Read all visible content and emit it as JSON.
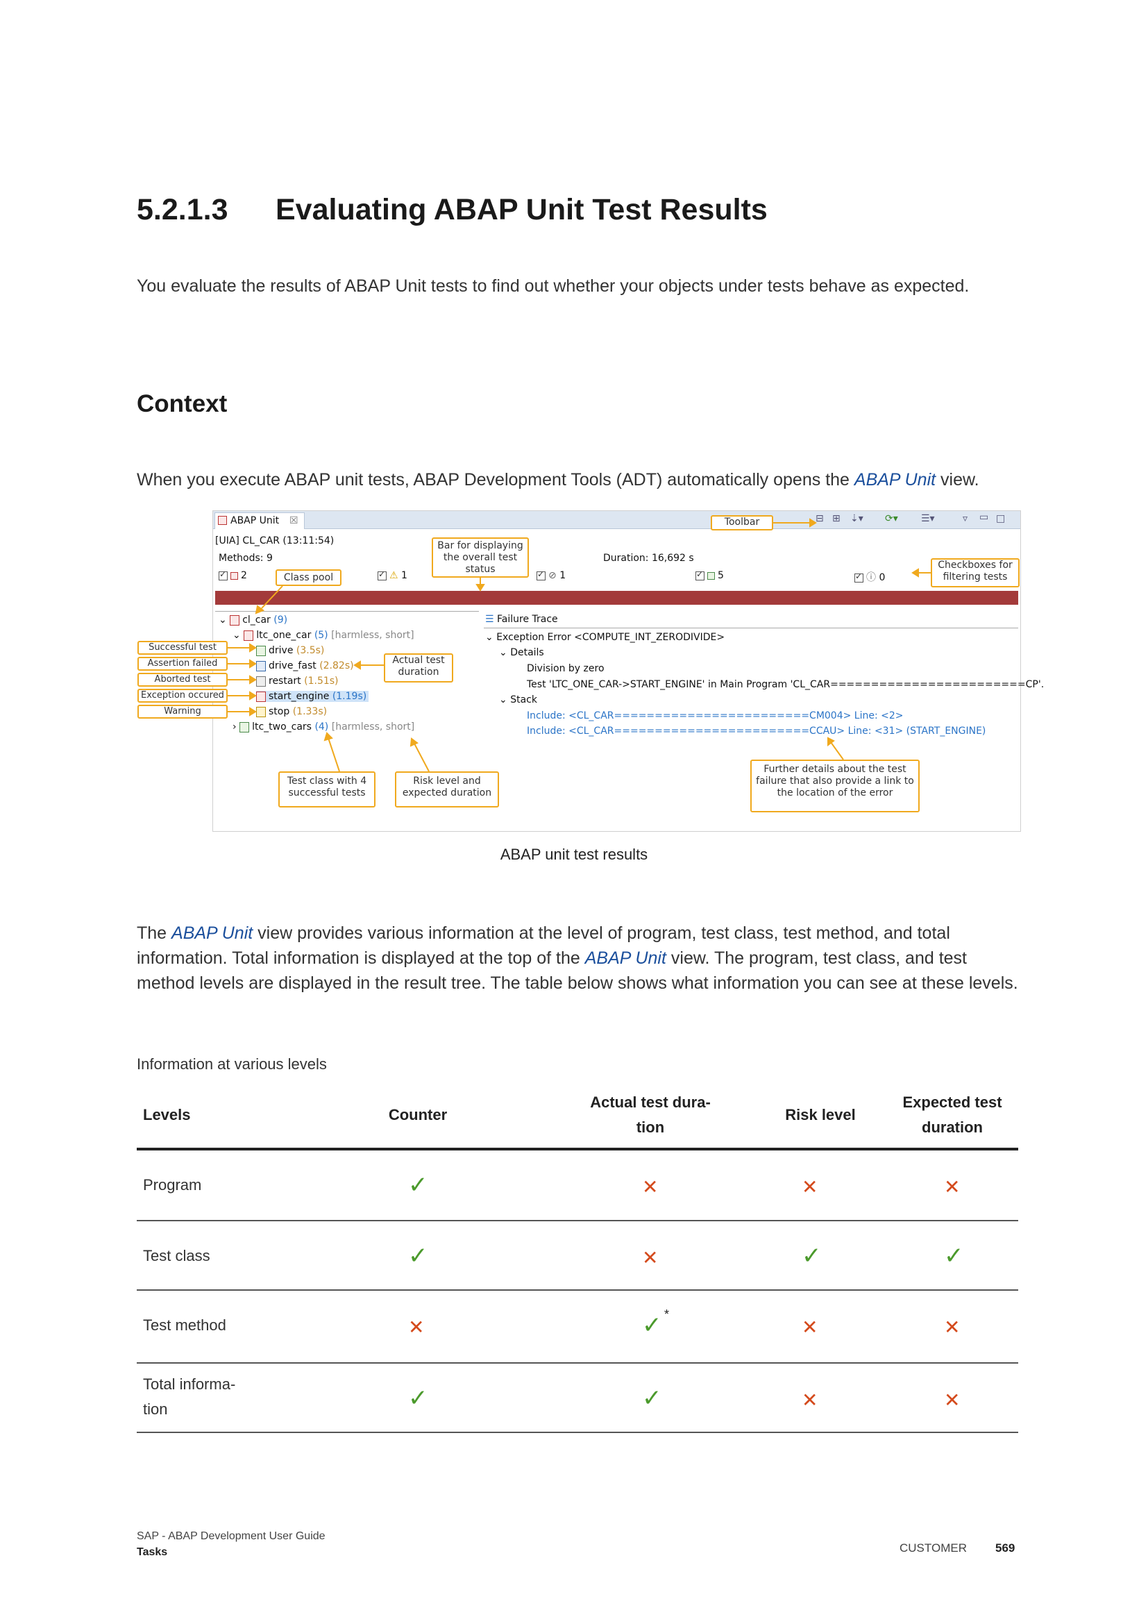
{
  "section": {
    "number": "5.2.1.3",
    "title": "Evaluating ABAP Unit Test Results"
  },
  "intro": "You evaluate the results of ABAP Unit tests to find out whether your objects under tests behave as expected.",
  "context": {
    "heading": "Context",
    "text_before": "When you execute ABAP unit tests, ABAP Development Tools (ADT) automatically opens the ",
    "link": "ABAP Unit",
    "text_after": " view."
  },
  "figure": {
    "tab_label": "ABAP Unit",
    "tab_close": "☒",
    "run_label": "[UIA] CL_CAR (13:11:54)",
    "methods": "Methods: 9",
    "duration": "Duration: 16,692 s",
    "counters": {
      "success": "2",
      "warning": "1",
      "aborted": "1",
      "passed": "5",
      "unknown": "0"
    },
    "tree": {
      "root": "cl_car",
      "root_count": "(9)",
      "class1": "ltc_one_car",
      "class1_count": "(5)",
      "class1_meta": "[harmless, short]",
      "methods": [
        {
          "name": "drive",
          "time": "(3.5s)"
        },
        {
          "name": "drive_fast",
          "time": "(2.82s)"
        },
        {
          "name": "restart",
          "time": "(1.51s)"
        },
        {
          "name": "start_engine",
          "time": "(1.19s)"
        },
        {
          "name": "stop",
          "time": "(1.33s)"
        }
      ],
      "class2": "ltc_two_cars",
      "class2_count": "(4)",
      "class2_meta": "[harmless, short]"
    },
    "trace": {
      "header": "Failure Trace",
      "exception": "Exception Error <COMPUTE_INT_ZERODIVIDE>",
      "details": "Details",
      "detail_1": "Division by zero",
      "detail_2": "Test 'LTC_ONE_CAR->START_ENGINE' in Main Program 'CL_CAR========================CP'.",
      "stack": "Stack",
      "include_1": "Include: <CL_CAR========================CM004> Line: <2>",
      "include_2": "Include: <CL_CAR========================CCAU> Line: <31> (START_ENGINE)"
    },
    "callouts": {
      "toolbar": "Toolbar",
      "bar": "Bar for displaying the overall test status",
      "class_pool": "Class pool",
      "checkboxes": "Checkboxes for filtering tests",
      "successful": "Successful test",
      "assertion": "Assertion failed",
      "aborted": "Aborted test",
      "exception": "Exception occured",
      "warning": "Warning",
      "actual_duration": "Actual test duration",
      "test_class": "Test class with 4 successful tests",
      "risk_level": "Risk level and expected duration",
      "further": "Further details about the test failure that also provide a link to the location of the error"
    },
    "caption": "ABAP unit test results"
  },
  "para2": {
    "t1": "The ",
    "link1": "ABAP Unit",
    "t2": " view provides various information at the level of program, test class, test method, and total information. Total information is displayed at the top of the ",
    "link2": "ABAP Unit",
    "t3": " view. The program, test class, and test method levels are displayed in the result tree. The table below shows what information you can see at these levels."
  },
  "table": {
    "title": "Information at various levels",
    "headers": [
      "Levels",
      "Counter",
      "Actual test dura-\ntion",
      "Risk level",
      "Expected test\nduration"
    ],
    "rows": [
      {
        "level": "Program",
        "values": [
          "yes",
          "no",
          "no",
          "no"
        ]
      },
      {
        "level": "Test class",
        "values": [
          "yes",
          "no",
          "yes",
          "yes"
        ]
      },
      {
        "level": "Test method",
        "values": [
          "no",
          "yes*",
          "no",
          "no"
        ]
      },
      {
        "level": "Total informa-\ntion",
        "values": [
          "yes",
          "yes",
          "no",
          "no"
        ]
      }
    ],
    "colors": {
      "yes": "#4b9a2c",
      "no": "#d44a1c"
    }
  },
  "footer": {
    "doc": "SAP - ABAP Development User Guide",
    "chapter": "Tasks",
    "label": "CUSTOMER",
    "page": "569"
  }
}
